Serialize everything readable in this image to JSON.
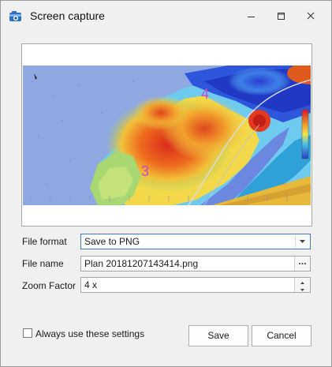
{
  "window": {
    "title": "Screen capture"
  },
  "preview": {
    "zone_labels": [
      "3",
      "4"
    ]
  },
  "form": {
    "file_format": {
      "label": "File format",
      "value": "Save to PNG"
    },
    "file_name": {
      "label": "File name",
      "value": "Plan 20181207143414.png",
      "browse_label": "···"
    },
    "zoom_factor": {
      "label": "Zoom Factor",
      "value": "4 x"
    }
  },
  "options": {
    "always_use_label": "Always use these settings",
    "always_use_checked": false
  },
  "buttons": {
    "save_label": "Save",
    "cancel_label": "Cancel"
  },
  "colors": {
    "accent": "#3a78d2",
    "zone_label": "#c04bd0"
  }
}
